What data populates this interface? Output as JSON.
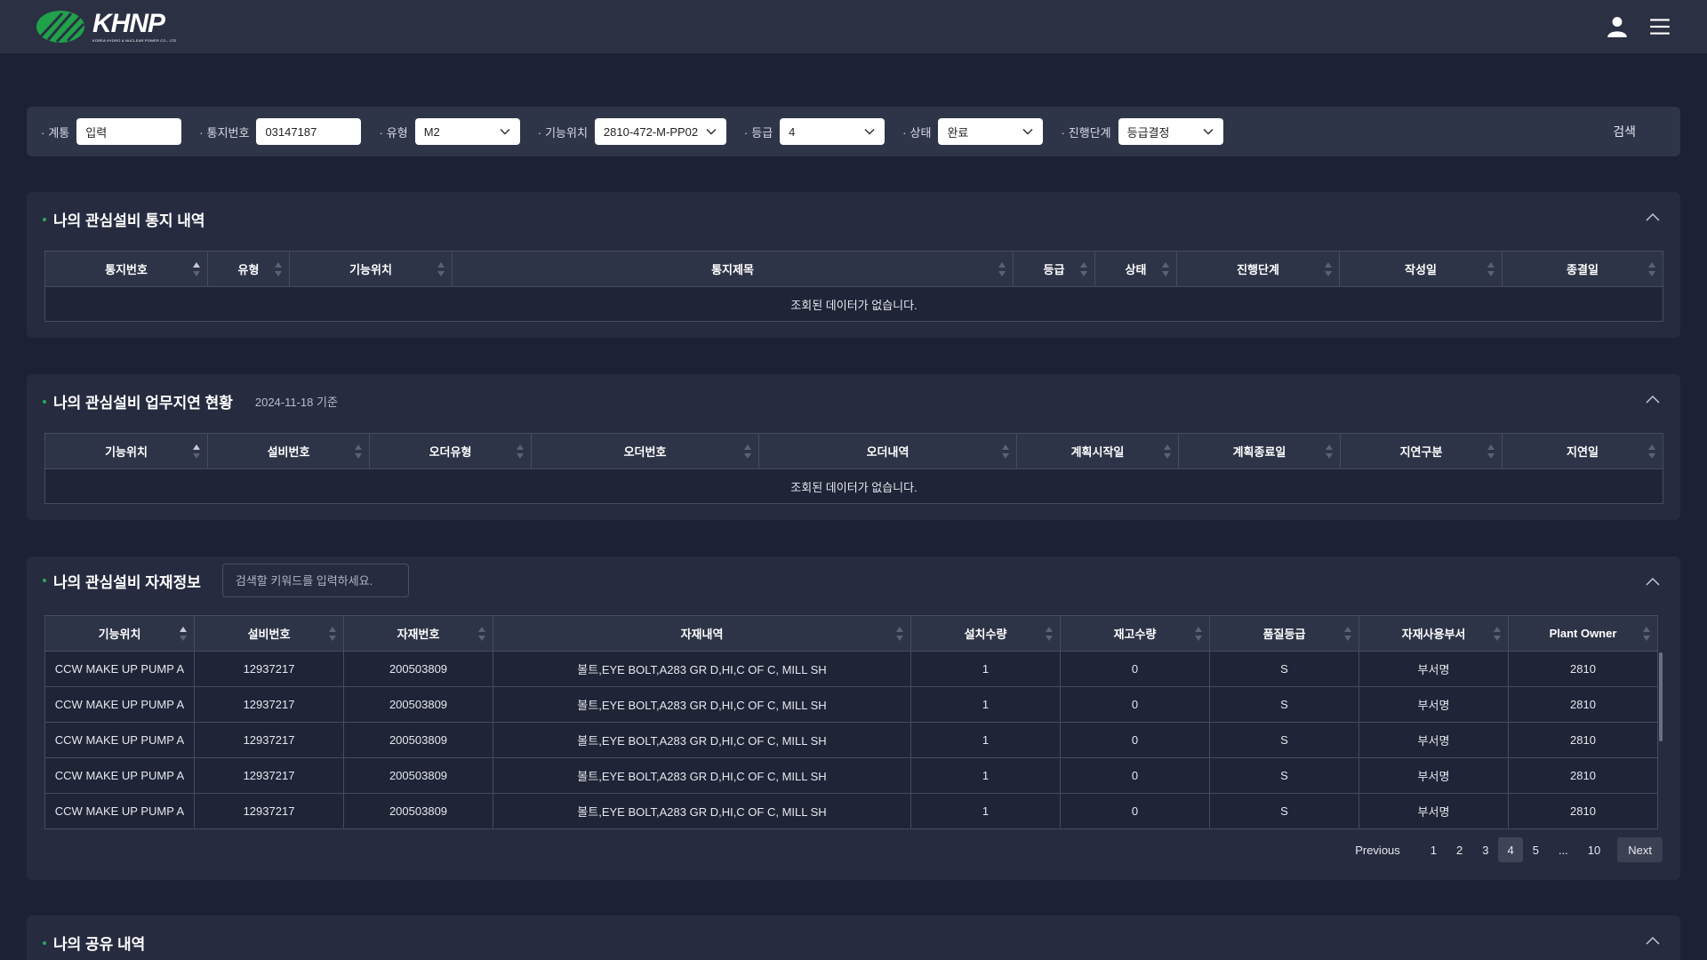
{
  "header": {
    "logo_text": "KHNP",
    "logo_sub": "KOREA HYDRO & NUCLEAR POWER CO., LTD",
    "colors": {
      "logo_green": "#1fa24a",
      "header_bg": "#2b3043"
    }
  },
  "search": {
    "fields": [
      {
        "label": "계통",
        "value": "입력"
      },
      {
        "label": "통지번호",
        "value": "03147187"
      },
      {
        "label": "유형",
        "value": "M2"
      },
      {
        "label": "기능위치",
        "value": "2810-472-M-PP02"
      },
      {
        "label": "등급",
        "value": "4"
      },
      {
        "label": "상태",
        "value": "완료"
      },
      {
        "label": "진행단계",
        "value": "등급결정"
      }
    ],
    "button_label": "검색"
  },
  "panel1": {
    "title": "나의 관심설비 통지 내역",
    "columns": [
      "통지번호",
      "유형",
      "기능위치",
      "통지제목",
      "등급",
      "상태",
      "진행단계",
      "작성일",
      "종결일"
    ],
    "empty_text": "조회된 데이터가 없습니다."
  },
  "panel2": {
    "title": "나의 관심설비 업무지연 현황",
    "subtitle": "2024-11-18 기준",
    "columns": [
      "기능위치",
      "설비번호",
      "오더유형",
      "오더번호",
      "오더내역",
      "계획시작일",
      "계획종료일",
      "지연구분",
      "지연일"
    ],
    "empty_text": "조회된 데이터가 없습니다."
  },
  "panel3": {
    "title": "나의 관심설비 자재정보",
    "keyword_placeholder": "검색할 키워드를 입력하세요.",
    "columns": [
      "기능위치",
      "설비번호",
      "자재번호",
      "자재내역",
      "설치수량",
      "재고수량",
      "품질등급",
      "자재사용부서",
      "Plant Owner"
    ],
    "rows": [
      [
        "CCW MAKE UP PUMP A",
        "12937217",
        "200503809",
        "볼트,EYE BOLT,A283 GR D,HI,C OF C, MILL SH",
        "1",
        "0",
        "S",
        "부서명",
        "2810"
      ],
      [
        "CCW MAKE UP PUMP A",
        "12937217",
        "200503809",
        "볼트,EYE BOLT,A283 GR D,HI,C OF C, MILL SH",
        "1",
        "0",
        "S",
        "부서명",
        "2810"
      ],
      [
        "CCW MAKE UP PUMP A",
        "12937217",
        "200503809",
        "볼트,EYE BOLT,A283 GR D,HI,C OF C, MILL SH",
        "1",
        "0",
        "S",
        "부서명",
        "2810"
      ],
      [
        "CCW MAKE UP PUMP A",
        "12937217",
        "200503809",
        "볼트,EYE BOLT,A283 GR D,HI,C OF C, MILL SH",
        "1",
        "0",
        "S",
        "부서명",
        "2810"
      ],
      [
        "CCW MAKE UP PUMP A",
        "12937217",
        "200503809",
        "볼트,EYE BOLT,A283 GR D,HI,C OF C, MILL SH",
        "1",
        "0",
        "S",
        "부서명",
        "2810"
      ]
    ],
    "pagination": {
      "previous": "Previous",
      "pages": [
        "1",
        "2",
        "3",
        "4",
        "5",
        "...",
        "10"
      ],
      "current": "4",
      "next": "Next"
    }
  },
  "panel4": {
    "title": "나의 공유 내역"
  },
  "icons": {
    "user": "user-icon",
    "menu": "hamburger-menu-icon",
    "select": "chevron-down-icon",
    "collapse": "chevron-up-icon",
    "sort": "sort-icon"
  }
}
